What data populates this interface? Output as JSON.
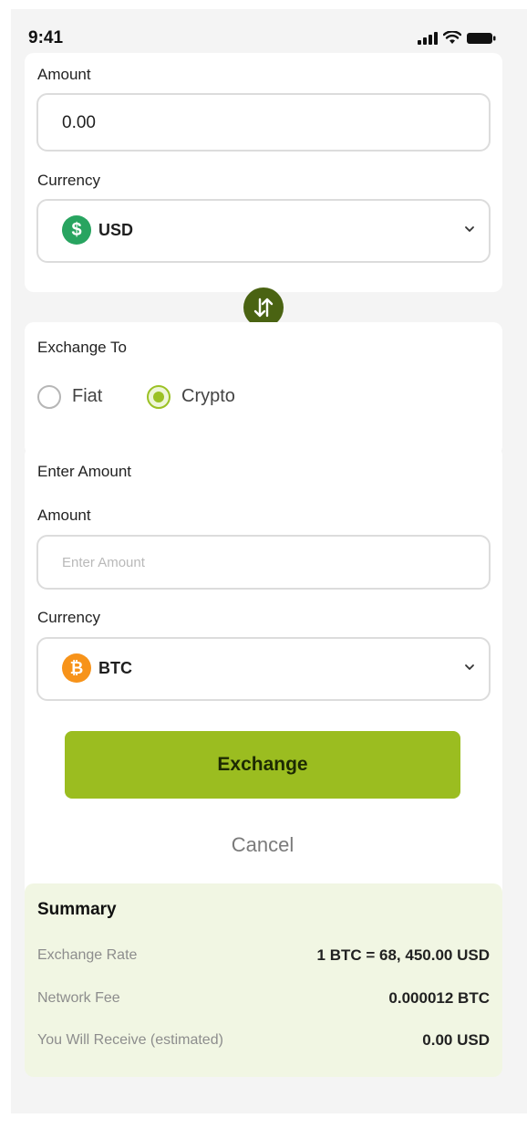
{
  "status_bar": {
    "time": "9:41"
  },
  "from": {
    "amount_label": "Amount",
    "amount_value": "0.00",
    "currency_label": "Currency",
    "currency_icon": "dollar-icon",
    "currency_code": "USD"
  },
  "to": {
    "exchange_to_label": "Exchange To",
    "options": [
      {
        "label": "Fiat",
        "selected": false
      },
      {
        "label": "Crypto",
        "selected": true
      }
    ],
    "section_title": "Enter Amount",
    "amount_label": "Amount",
    "amount_placeholder": "Enter Amount",
    "currency_label": "Currency",
    "currency_icon": "bitcoin-icon",
    "currency_code": "BTC"
  },
  "actions": {
    "exchange_label": "Exchange",
    "cancel_label": "Cancel"
  },
  "summary": {
    "title": "Summary",
    "rows": [
      {
        "label": "Exchange Rate",
        "value": "1 BTC = 68, 450.00 USD"
      },
      {
        "label": "Network Fee",
        "value": "0.000012 BTC"
      },
      {
        "label": "You Will Receive (estimated)",
        "value": "0.00 USD"
      }
    ]
  },
  "colors": {
    "accent": "#9bbd20",
    "swap_button": "#4a6312",
    "usd_coin": "#28a460",
    "btc_coin": "#f7931a",
    "summary_bg": "#f1f6e3"
  }
}
